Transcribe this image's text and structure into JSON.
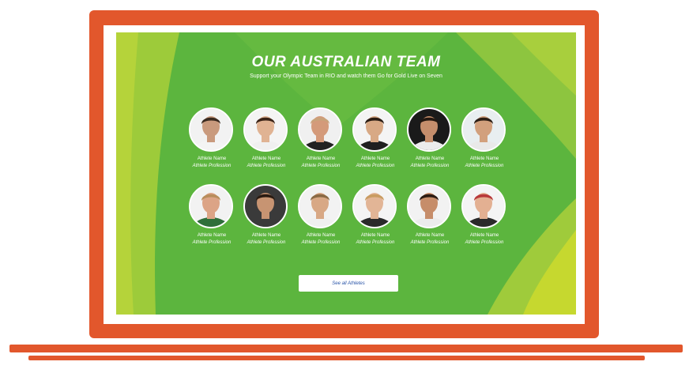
{
  "title": "OUR AUSTRALIAN TEAM",
  "subtitle": "Support your Olympic Team in RIO and watch them Go for Gold Live on Seven",
  "athletes": [
    {
      "name": "Athlete Name",
      "profession": "Athlete Profession",
      "skin": "#c99a7d",
      "hair": "#3a2a1f",
      "bg": "#f2f2f2",
      "shirt": "#f4f4f4"
    },
    {
      "name": "Athlete Name",
      "profession": "Athlete Profession",
      "skin": "#e0b393",
      "hair": "#3b2418",
      "bg": "#f4f4f4",
      "shirt": "#f0f0f0"
    },
    {
      "name": "Athlete Name",
      "profession": "Athlete Profession",
      "skin": "#d49a7a",
      "hair": "#c9a27a",
      "bg": "#f0f0f0",
      "shirt": "#222222"
    },
    {
      "name": "Athlete Name",
      "profession": "Athlete Profession",
      "skin": "#d8a985",
      "hair": "#2b1d14",
      "bg": "#f4f4f4",
      "shirt": "#202020"
    },
    {
      "name": "Athlete Name",
      "profession": "Athlete Profession",
      "skin": "#c58e6c",
      "hair": "#231710",
      "bg": "#1a1a1a",
      "shirt": "#ececec"
    },
    {
      "name": "Athlete Name",
      "profession": "Athlete Profession",
      "skin": "#d2a07d",
      "hair": "#2c1e15",
      "bg": "#e8eef0",
      "shirt": "#e9e9e9"
    },
    {
      "name": "Athlete Name",
      "profession": "Athlete Profession",
      "skin": "#dca486",
      "hair": "#b88d5c",
      "bg": "#f2f2f2",
      "shirt": "#2f6f3a"
    },
    {
      "name": "Athlete Name",
      "profession": "Athlete Profession",
      "skin": "#c79472",
      "hair": "#2a1b12",
      "bg": "#3a3a3a",
      "shirt": "#3a3a3a"
    },
    {
      "name": "Athlete Name",
      "profession": "Athlete Profession",
      "skin": "#d8a885",
      "hair": "#8a6a45",
      "bg": "#f2f2f2",
      "shirt": "#f0f0f0"
    },
    {
      "name": "Athlete Name",
      "profession": "Athlete Profession",
      "skin": "#e2b596",
      "hair": "#c99c62",
      "bg": "#f4f4f4",
      "shirt": "#2a2a2a"
    },
    {
      "name": "Athlete Name",
      "profession": "Athlete Profession",
      "skin": "#c68d6a",
      "hair": "#2a1a12",
      "bg": "#f2f2f2",
      "shirt": "#ececec"
    },
    {
      "name": "Athlete Name",
      "profession": "Athlete Profession",
      "skin": "#e3b092",
      "hair": "#b8393a",
      "bg": "#f4f4f4",
      "shirt": "#2a2a2a"
    }
  ],
  "see_all_label": "See all Athletes",
  "colors": {
    "frame": "#e2572c",
    "green": "#5cb53e",
    "lime": "#b5d33a",
    "button_text": "#2a55a8"
  }
}
